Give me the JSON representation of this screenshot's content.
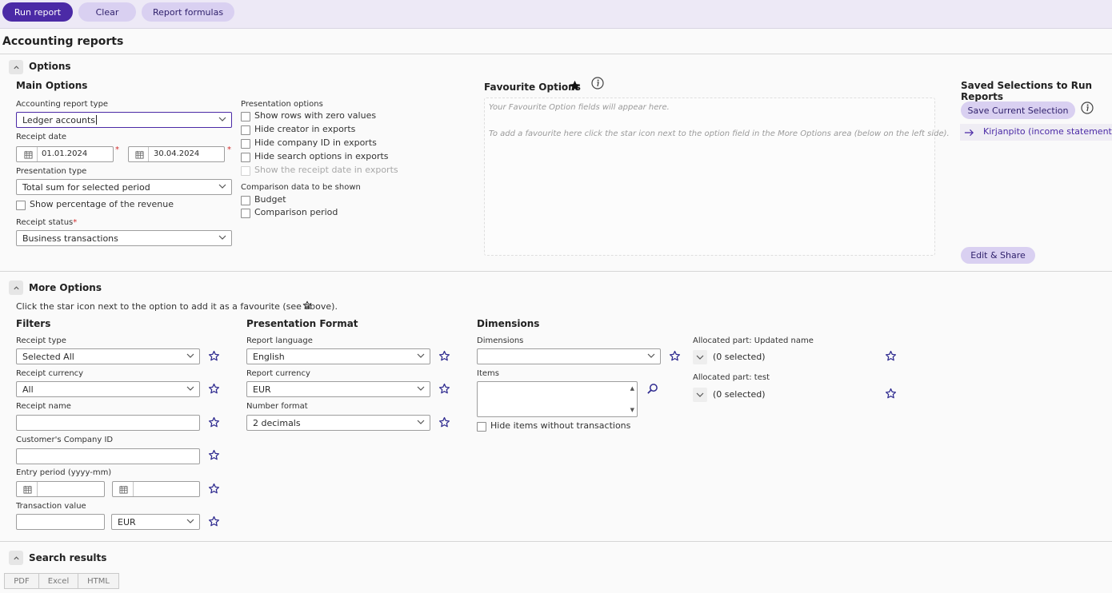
{
  "toolbar": {
    "run_report": "Run report",
    "clear": "Clear",
    "report_formulas": "Report formulas"
  },
  "page_title": "Accounting reports",
  "options": {
    "section_title": "Options",
    "main_options": {
      "title": "Main Options",
      "report_type_label": "Accounting report type",
      "report_type_value": "Ledger accounts",
      "receipt_date_label": "Receipt date",
      "date_from": "01.01.2024",
      "date_to": "30.04.2024",
      "required_mark": "*",
      "presentation_type_label": "Presentation type",
      "presentation_type_value": "Total sum for selected period",
      "show_percentage": "Show percentage of the revenue",
      "receipt_status_label": "Receipt status",
      "receipt_status_value": "Business transactions"
    },
    "presentation_options": {
      "label": "Presentation options",
      "items": [
        "Show rows with zero values",
        "Hide creator in exports",
        "Hide company ID in exports",
        "Hide search options in exports",
        "Show the receipt date in exports"
      ],
      "comparison_label": "Comparison data to be shown",
      "comparison_items": [
        "Budget",
        "Comparison period"
      ]
    },
    "favourite": {
      "title": "Favourite Options",
      "note1": "Your Favourite Option fields will appear here.",
      "note2": "To add a favourite here click the star icon next to the option field in the More Options area (below on the left side)."
    },
    "saved": {
      "title": "Saved Selections to Run Reports",
      "save_button": "Save Current Selection",
      "item": "Kirjanpito (income statement)",
      "edit_share": "Edit & Share"
    }
  },
  "more_options": {
    "section_title": "More Options",
    "hint": "Click the star icon next to the option to add it as a favourite (see above).",
    "filters": {
      "title": "Filters",
      "receipt_type_label": "Receipt type",
      "receipt_type_value": "Selected All",
      "receipt_currency_label": "Receipt currency",
      "receipt_currency_value": "All",
      "receipt_name_label": "Receipt name",
      "customer_company_id_label": "Customer's Company ID",
      "entry_period_label": "Entry period (yyyy-mm)",
      "transaction_value_label": "Transaction value",
      "transaction_currency": "EUR"
    },
    "presentation_format": {
      "title": "Presentation Format",
      "language_label": "Report language",
      "language_value": "English",
      "currency_label": "Report currency",
      "currency_value": "EUR",
      "number_format_label": "Number format",
      "number_format_value": "2 decimals"
    },
    "dimensions": {
      "title": "Dimensions",
      "dimensions_label": "Dimensions",
      "dimensions_value": "",
      "items_label": "Items",
      "hide_items": "Hide items without transactions",
      "allocated": [
        {
          "label": "Allocated part: Updated name",
          "value": "(0 selected)"
        },
        {
          "label": "Allocated part: test",
          "value": "(0 selected)"
        }
      ]
    }
  },
  "search_results": {
    "title": "Search results",
    "exports": [
      "PDF",
      "Excel",
      "HTML"
    ]
  },
  "colors": {
    "accent": "#4b2aa6",
    "accent_light": "#d9d0f1",
    "toolbar_bg": "#ede9f6",
    "required": "#d12b2b"
  }
}
